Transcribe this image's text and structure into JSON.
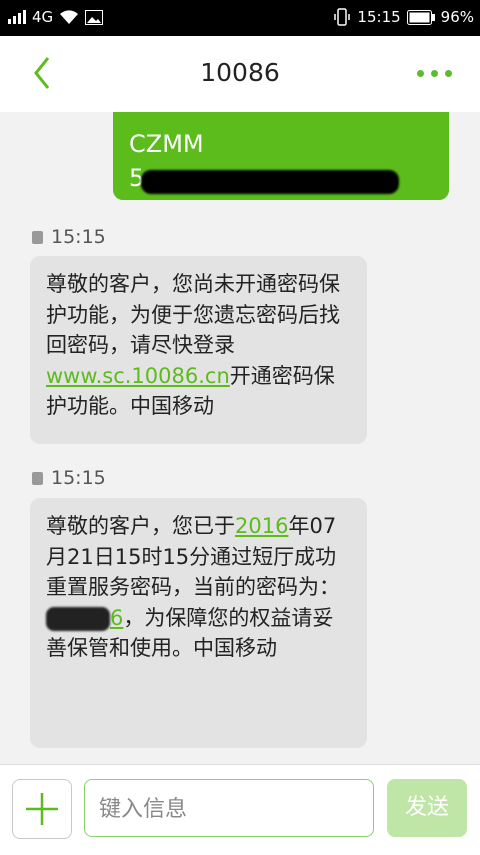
{
  "statusbar": {
    "network": "4G",
    "time": "15:15",
    "battery": "96%"
  },
  "header": {
    "title": "10086"
  },
  "sent_message": {
    "line1": "CZMM",
    "line2_visible": "5"
  },
  "received": [
    {
      "time": "15:15",
      "text_before_link": "尊敬的客户，您尚未开通密码保护功能，为便于您遗忘密码后找回密码，请尽快登录",
      "link": "www.sc.10086.cn",
      "text_after_link": "开通密码保护功能。中国移动"
    },
    {
      "time": "15:15",
      "text_part1": "尊敬的客户，您已于",
      "year_link": "2016",
      "text_part2": "年07月21日15时15分通过短厅成功重置服务密码，当前的密码为：",
      "code_visible_end": "6",
      "text_part3": "，为保障您的权益请妥善保管和使用。中国移动"
    }
  ],
  "composer": {
    "placeholder": "键入信息",
    "send_label": "发送"
  },
  "colors": {
    "accent": "#5bbc1b",
    "bubble": "#e3e3e3"
  }
}
